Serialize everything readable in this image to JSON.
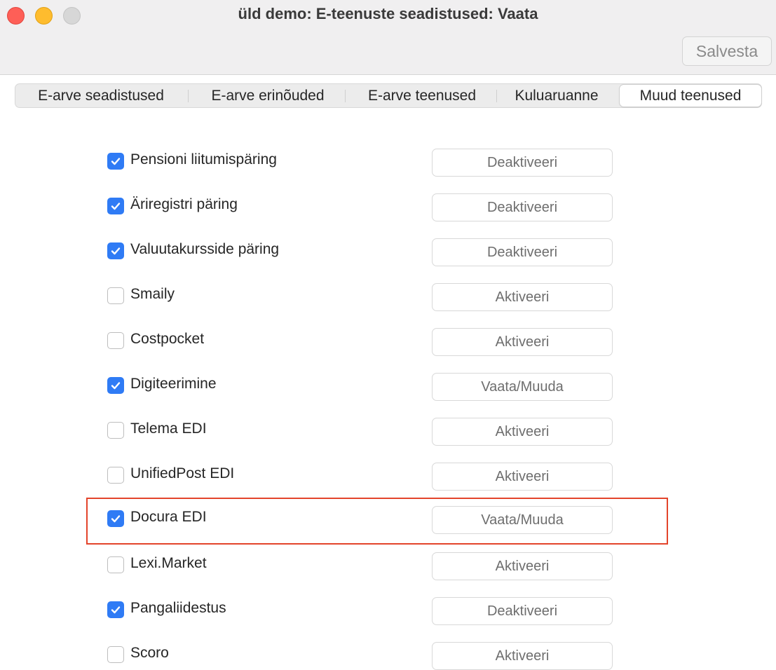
{
  "window": {
    "title": "üld demo: E-teenuste seadistused: Vaata"
  },
  "toolbar": {
    "save_label": "Salvesta"
  },
  "tabs": [
    {
      "label": "E-arve seadistused",
      "active": false
    },
    {
      "label": "E-arve erinõuded",
      "active": false
    },
    {
      "label": "E-arve teenused",
      "active": false
    },
    {
      "label": "Kuluaruanne",
      "active": false
    },
    {
      "label": "Muud teenused",
      "active": true
    }
  ],
  "services": [
    {
      "label": "Pensioni liitumispäring",
      "checked": true,
      "button": "Deaktiveeri"
    },
    {
      "label": "Äriregistri päring",
      "checked": true,
      "button": "Deaktiveeri"
    },
    {
      "label": "Valuutakursside päring",
      "checked": true,
      "button": "Deaktiveeri"
    },
    {
      "label": "Smaily",
      "checked": false,
      "button": "Aktiveeri"
    },
    {
      "label": "Costpocket",
      "checked": false,
      "button": "Aktiveeri"
    },
    {
      "label": "Digiteerimine",
      "checked": true,
      "button": "Vaata/Muuda"
    },
    {
      "label": "Telema EDI",
      "checked": false,
      "button": "Aktiveeri"
    },
    {
      "label": "UnifiedPost EDI",
      "checked": false,
      "button": "Aktiveeri"
    },
    {
      "label": "Docura EDI",
      "checked": true,
      "button": "Vaata/Muuda",
      "highlighted": true
    },
    {
      "label": "Lexi.Market",
      "checked": false,
      "button": "Aktiveeri"
    },
    {
      "label": "Pangaliidestus",
      "checked": true,
      "button": "Deaktiveeri"
    },
    {
      "label": "Scoro",
      "checked": false,
      "button": "Aktiveeri"
    }
  ],
  "colors": {
    "accent": "#2f7bf5",
    "highlight_border": "#e3442b",
    "close": "#fe5f57",
    "minimize": "#febc2e",
    "zoom": "#d7d7d7"
  }
}
